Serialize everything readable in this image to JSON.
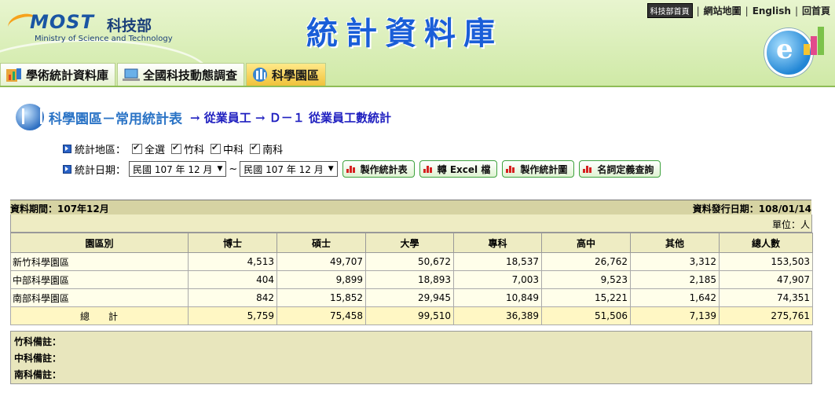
{
  "header": {
    "logo_brand": "MOST",
    "logo_cn": "科技部",
    "logo_en": "Ministry of Science and Technology",
    "site_title": "統計資料庫",
    "top_links": [
      "科技部首頁",
      "網站地圖",
      "English",
      "回首頁"
    ]
  },
  "tabs": [
    {
      "label": "學術統計資料庫",
      "active": false
    },
    {
      "label": "全國科技動態調查",
      "active": false
    },
    {
      "label": "科學園區",
      "active": true
    }
  ],
  "page": {
    "section_title": "科學園區－常用統計表",
    "breadcrumb": "→ 從業員工 → Ｄ－１ 從業員工數統計"
  },
  "filters": {
    "region_label": "統計地區：",
    "regions": [
      {
        "label": "全選",
        "checked": true
      },
      {
        "label": "竹科",
        "checked": true
      },
      {
        "label": "中科",
        "checked": true
      },
      {
        "label": "南科",
        "checked": true
      }
    ],
    "date_label": "統計日期：",
    "date_from": "民國 107 年 12 月",
    "date_sep": "~",
    "date_to": "民國 107 年 12 月",
    "buttons": [
      "製作統計表",
      "轉 Excel 檔",
      "製作統計圖",
      "名詞定義查詢"
    ]
  },
  "table": {
    "period": "資料期間：107年12月",
    "release_date": "資料發行日期：108/01/14",
    "unit": "單位：人",
    "headers": [
      "園區別",
      "博士",
      "碩士",
      "大學",
      "專科",
      "高中",
      "其他",
      "總人數"
    ],
    "rows": [
      [
        "新竹科學園區",
        "4,513",
        "49,707",
        "50,672",
        "18,537",
        "26,762",
        "3,312",
        "153,503"
      ],
      [
        "中部科學園區",
        "404",
        "9,899",
        "18,893",
        "7,003",
        "9,523",
        "2,185",
        "47,907"
      ],
      [
        "南部科學園區",
        "842",
        "15,852",
        "29,945",
        "10,849",
        "15,221",
        "1,642",
        "74,351"
      ]
    ],
    "total": [
      "總　　計",
      "5,759",
      "75,458",
      "99,510",
      "36,389",
      "51,506",
      "7,139",
      "275,761"
    ]
  },
  "notes": [
    "竹科備註：",
    "中科備註：",
    "南科備註："
  ],
  "colors": {
    "accent": "#2b74c6",
    "header_green": "#cfe9a6",
    "table_header": "#eeecc3",
    "button_border": "#3ea23e"
  }
}
